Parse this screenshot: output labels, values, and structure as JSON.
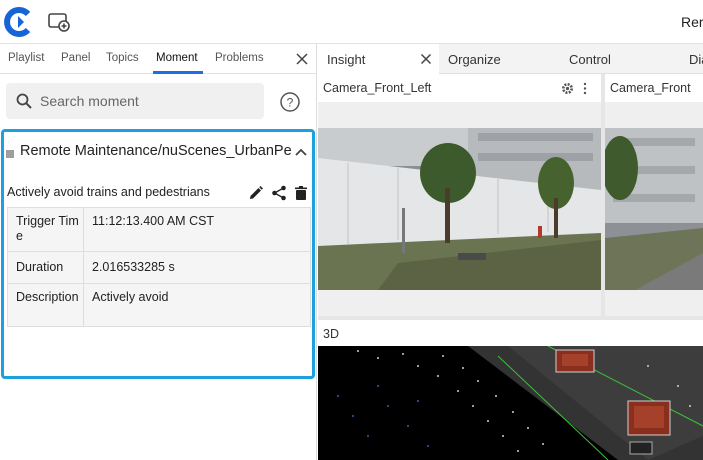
{
  "topbar": {
    "right_text": "Rer"
  },
  "left_tabs": [
    {
      "label": "Playlist"
    },
    {
      "label": "Panel"
    },
    {
      "label": "Topics"
    },
    {
      "label": "Moment",
      "active": true
    },
    {
      "label": "Problems"
    }
  ],
  "search": {
    "placeholder": "Search moment",
    "value": ""
  },
  "moment": {
    "title": "Remote Maintenance/nuScenes_UrbanPe",
    "description": "Actively avoid trains and pedestrians",
    "fields": [
      {
        "key": "Trigger Time",
        "value": "11:12:13.400 AM CST"
      },
      {
        "key": "Duration",
        "value": "2.016533285 s"
      },
      {
        "key": "Description",
        "value": "Actively avoid"
      }
    ]
  },
  "right_tabs": [
    {
      "label": "Insight",
      "active": true
    },
    {
      "label": "Organize"
    },
    {
      "label": "Control"
    },
    {
      "label": "Dia"
    }
  ],
  "panes": {
    "camera_front_left": "Camera_Front_Left",
    "camera_front": "Camera_Front",
    "view_3d": "3D"
  },
  "colors": {
    "accent_blue": "#1d6fe0",
    "selection_border": "#1ca0de",
    "logo_blue": "#1565d8"
  }
}
